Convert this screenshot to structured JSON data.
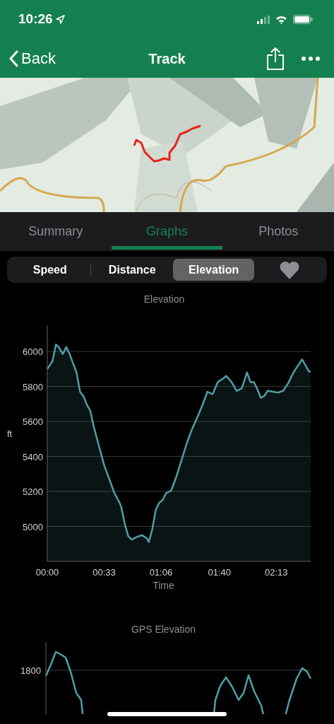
{
  "status_bar": {
    "time": "10:26"
  },
  "nav": {
    "back": "Back",
    "title": "Track"
  },
  "tabs": [
    {
      "label": "Summary",
      "selected": false
    },
    {
      "label": "Graphs",
      "selected": true
    },
    {
      "label": "Photos",
      "selected": false
    }
  ],
  "segments": [
    {
      "label": "Speed",
      "selected": false
    },
    {
      "label": "Distance",
      "selected": false
    },
    {
      "label": "Elevation",
      "selected": true
    }
  ],
  "elevation_chart": {
    "chart_data": {
      "type": "area",
      "title": "Elevation",
      "xlabel": "Time",
      "ylabel": "ft",
      "x": [
        0,
        3,
        5,
        7,
        9,
        11,
        13,
        15,
        17,
        19,
        21,
        23,
        25,
        27,
        30,
        33,
        36,
        39,
        42,
        43,
        45,
        47,
        49,
        52,
        55,
        58,
        59,
        61,
        63,
        65,
        67,
        69,
        72,
        75,
        78,
        81,
        84,
        87,
        90,
        93,
        96,
        99,
        102,
        104,
        107,
        110,
        113,
        116,
        118,
        120,
        122,
        124,
        126,
        128,
        131,
        134,
        137,
        140,
        143,
        146,
        148,
        150,
        152,
        153
      ],
      "grid": true,
      "series": [
        {
          "color": "#4e9ea5",
          "values": [
            5900,
            5945,
            6040,
            6020,
            5985,
            6025,
            5985,
            5930,
            5880,
            5770,
            5745,
            5695,
            5660,
            5570,
            5460,
            5350,
            5270,
            5190,
            5135,
            5110,
            5015,
            4945,
            4925,
            4940,
            4950,
            4930,
            4910,
            4985,
            5095,
            5135,
            5150,
            5190,
            5205,
            5285,
            5380,
            5475,
            5555,
            5620,
            5690,
            5770,
            5755,
            5825,
            5845,
            5860,
            5825,
            5775,
            5790,
            5880,
            5825,
            5825,
            5785,
            5735,
            5745,
            5775,
            5770,
            5765,
            5775,
            5820,
            5880,
            5925,
            5955,
            5920,
            5885,
            5885
          ]
        }
      ],
      "xlim": [
        0,
        153
      ],
      "ylim": [
        4800,
        6150
      ],
      "xticks": [
        {
          "value": 0,
          "label": "00:00"
        },
        {
          "value": 33,
          "label": "00:33"
        },
        {
          "value": 66,
          "label": "01:06"
        },
        {
          "value": 100,
          "label": "01:40"
        },
        {
          "value": 133,
          "label": "02:13"
        }
      ],
      "yticks": [
        5000,
        5200,
        5400,
        5600,
        5800,
        6000
      ]
    }
  },
  "gps_chart": {
    "title": "GPS Elevation",
    "ytick_label": "1800"
  }
}
